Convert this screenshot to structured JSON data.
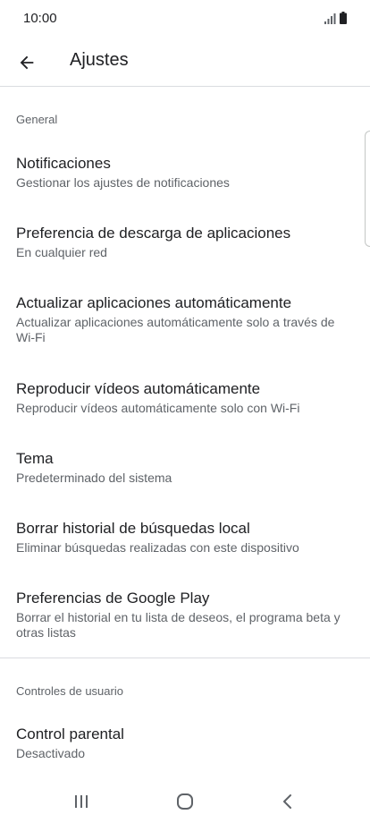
{
  "status_bar": {
    "time": "10:00"
  },
  "app_bar": {
    "title": "Ajustes",
    "back_icon": "arrow-back-icon"
  },
  "sections": [
    {
      "header": "General",
      "items": [
        {
          "title": "Notificaciones",
          "summary": "Gestionar los ajustes de notificaciones"
        },
        {
          "title": "Preferencia de descarga de aplicaciones",
          "summary": "En cualquier red"
        },
        {
          "title": "Actualizar aplicaciones automáticamente",
          "summary": "Actualizar aplicaciones automáticamente solo a través de Wi-Fi"
        },
        {
          "title": "Reproducir vídeos automáticamente",
          "summary": "Reproducir vídeos automáticamente solo con Wi-Fi"
        },
        {
          "title": "Tema",
          "summary": "Predeterminado del sistema"
        },
        {
          "title": "Borrar historial de búsquedas local",
          "summary": "Eliminar búsquedas realizadas con este dispositivo"
        },
        {
          "title": "Preferencias de Google Play",
          "summary": "Borrar el historial en tu lista de deseos, el programa beta y otras listas"
        }
      ]
    },
    {
      "header": "Controles de usuario",
      "items": [
        {
          "title": "Control parental",
          "summary": "Desactivado"
        }
      ]
    }
  ],
  "nav_bar": {
    "recents_icon": "recents-icon",
    "home_icon": "home-icon",
    "back_icon": "nav-back-icon"
  },
  "colors": {
    "text_primary": "#202124",
    "text_secondary": "#5f6368",
    "divider": "#dadce0",
    "background": "#ffffff"
  }
}
